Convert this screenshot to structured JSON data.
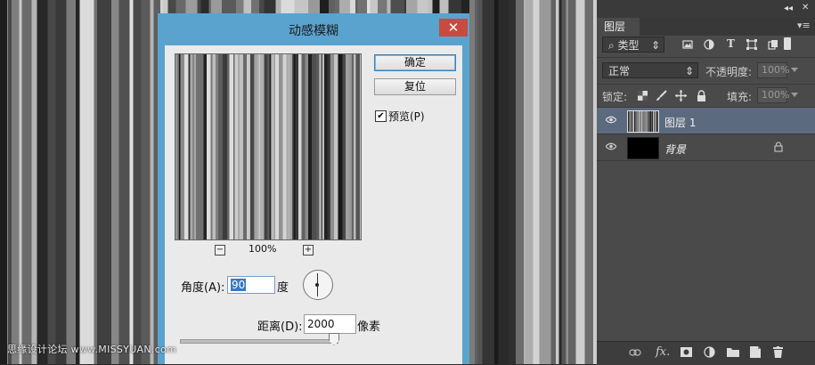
{
  "dialog": {
    "title": "动感模糊",
    "close_glyph": "✕",
    "ok_label": "确定",
    "reset_label": "复位",
    "preview_checkbox": {
      "label": "预览(P)",
      "checked": true,
      "glyph": "✔"
    },
    "zoom": {
      "value": "100%",
      "minus": "−",
      "plus": "+"
    },
    "angle": {
      "label": "角度(A):",
      "value": "90",
      "unit": "度"
    },
    "distance": {
      "label": "距离(D):",
      "value": "2000",
      "unit": "像素"
    }
  },
  "layers_panel": {
    "tab_label": "图层",
    "collapse_glyph": "◂◂",
    "close_glyph": "✕",
    "menu_glyph": "▾≡",
    "filter": {
      "label": "⌕ 类型",
      "arrow": "⇕",
      "icons": [
        "image-filter-icon",
        "adjustment-filter-icon",
        "type-filter-icon",
        "shape-filter-icon",
        "smart-object-filter-icon"
      ]
    },
    "blend_mode": {
      "value": "正常",
      "arrow": "⇕"
    },
    "opacity": {
      "label": "不透明度:",
      "value": "100%"
    },
    "lock": {
      "label": "锁定:"
    },
    "fill": {
      "label": "填充:",
      "value": "100%"
    },
    "layers": [
      {
        "name": "图层 1",
        "selected": true,
        "visible": true
      },
      {
        "name": "背景",
        "selected": false,
        "visible": true,
        "locked": true
      }
    ],
    "bottom_icons": [
      "link-icon",
      "fx-icon",
      "mask-icon",
      "adjustment-icon",
      "group-folder-icon",
      "new-layer-icon",
      "trash-icon"
    ]
  },
  "watermark": "思缘设计论坛 www.MISSYUAN.com",
  "colors": {
    "dialog_frame": "#5aa3cf",
    "close_button": "#c94a3f",
    "selected_layer": "#5b6a7e",
    "panel_bg": "#4a4a4a"
  }
}
